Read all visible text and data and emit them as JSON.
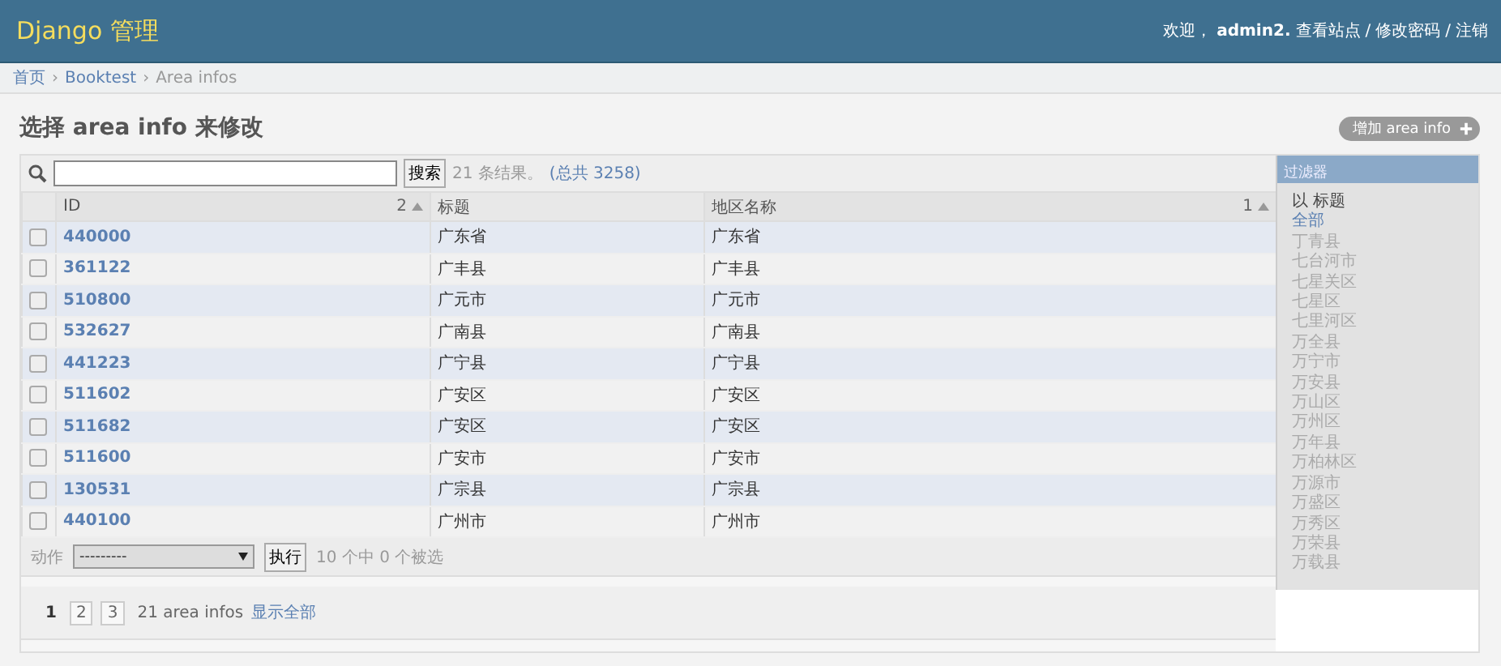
{
  "header": {
    "brand": "Django 管理",
    "welcome": "欢迎，",
    "user": "admin2",
    "user_end": ".",
    "links": [
      "查看站点",
      "修改密码",
      "注销"
    ],
    "separator": "/"
  },
  "breadcrumbs": {
    "items": [
      "首页",
      "Booktest",
      "Area infos"
    ],
    "separator": "›"
  },
  "title": "选择 area info 来修改",
  "add_button": "增加 area info",
  "search": {
    "button": "搜索",
    "result": "21 条结果。",
    "total": "(总共 3258)"
  },
  "columns": [
    {
      "label": "ID",
      "sort_priority": "2",
      "sorted": true
    },
    {
      "label": "标题",
      "sorted": false
    },
    {
      "label": "地区名称",
      "sort_priority": "1",
      "sorted": true
    }
  ],
  "rows": [
    {
      "id": "440000",
      "title": "广东省",
      "name": "广东省",
      "checked": false
    },
    {
      "id": "361122",
      "title": "广丰县",
      "name": "广丰县",
      "checked": false
    },
    {
      "id": "510800",
      "title": "广元市",
      "name": "广元市",
      "checked": false
    },
    {
      "id": "532627",
      "title": "广南县",
      "name": "广南县",
      "checked": false
    },
    {
      "id": "441223",
      "title": "广宁县",
      "name": "广宁县",
      "checked": false
    },
    {
      "id": "511602",
      "title": "广安区",
      "name": "广安区",
      "checked": false
    },
    {
      "id": "511682",
      "title": "广安区",
      "name": "广安区",
      "checked": false
    },
    {
      "id": "511600",
      "title": "广安市",
      "name": "广安市",
      "checked": false
    },
    {
      "id": "130531",
      "title": "广宗县",
      "name": "广宗县",
      "checked": false
    },
    {
      "id": "440100",
      "title": "广州市",
      "name": "广州市",
      "checked": false
    }
  ],
  "actions": {
    "label": "动作",
    "select": "---------",
    "button": "执行",
    "counter": "10 个中 0 个被选"
  },
  "pagination": {
    "pages": [
      {
        "label": "1",
        "selected": true
      },
      {
        "label": "2",
        "selected": false
      },
      {
        "label": "3",
        "selected": false
      }
    ],
    "count": "21 area infos",
    "show_all": "显示全部"
  },
  "filter": {
    "title": "过滤器",
    "heading": "以 标题",
    "items": [
      {
        "label": "全部",
        "selected": true
      },
      {
        "label": "丁青县",
        "selected": false
      },
      {
        "label": "七台河市",
        "selected": false
      },
      {
        "label": "七星关区",
        "selected": false
      },
      {
        "label": "七星区",
        "selected": false
      },
      {
        "label": "七里河区",
        "selected": false
      },
      {
        "label": "万全县",
        "selected": false
      },
      {
        "label": "万宁市",
        "selected": false
      },
      {
        "label": "万安县",
        "selected": false
      },
      {
        "label": "万山区",
        "selected": false
      },
      {
        "label": "万州区",
        "selected": false
      },
      {
        "label": "万年县",
        "selected": false
      },
      {
        "label": "万柏林区",
        "selected": false
      },
      {
        "label": "万源市",
        "selected": false
      },
      {
        "label": "万盛区",
        "selected": false
      },
      {
        "label": "万秀区",
        "selected": false
      },
      {
        "label": "万荣县",
        "selected": false
      },
      {
        "label": "万载县",
        "selected": false
      }
    ]
  }
}
